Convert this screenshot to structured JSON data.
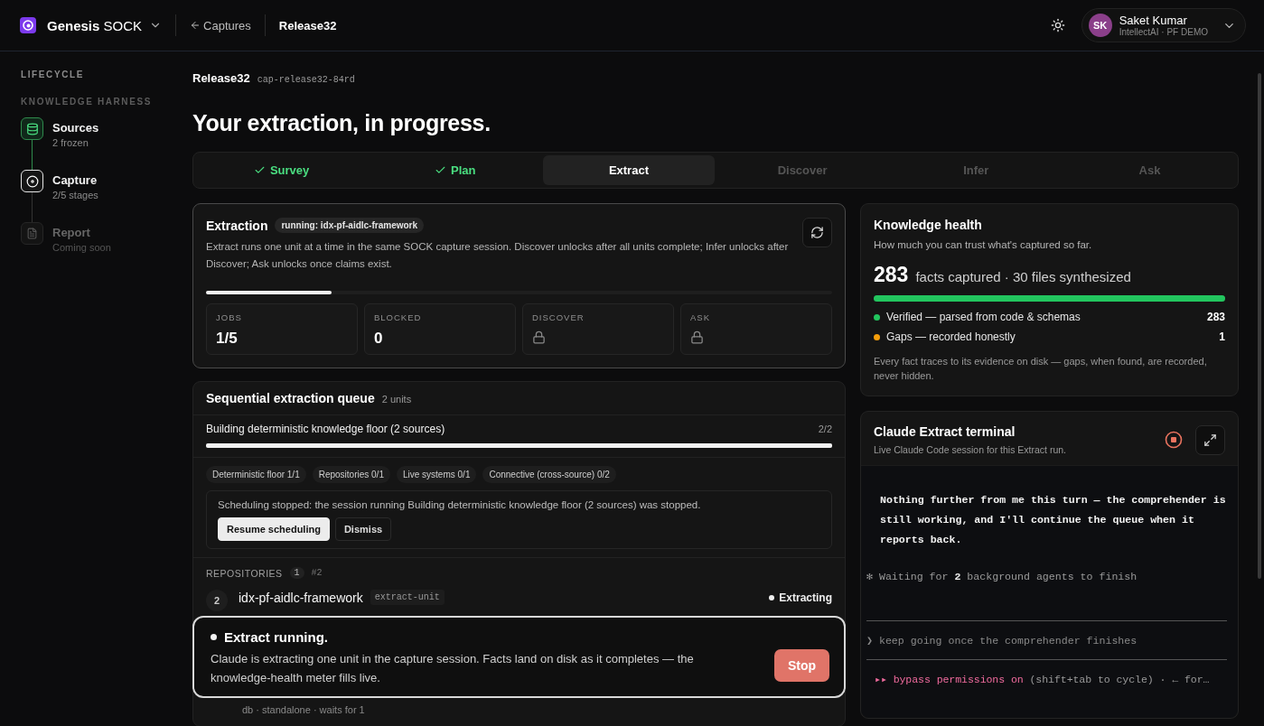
{
  "topbar": {
    "brand_bold": "Genesis",
    "brand_rest": "SOCK",
    "back": "Captures",
    "crumb": "Release32",
    "user": {
      "initials": "SK",
      "name": "Saket Kumar",
      "org": "IntellectAI · PF DEMO"
    }
  },
  "sidebar": {
    "section": "LIFECYCLE",
    "group": "KNOWLEDGE HARNESS",
    "steps": [
      {
        "label": "Sources",
        "sub": "2 frozen",
        "kind": "done"
      },
      {
        "label": "Capture",
        "sub": "2/5 stages",
        "kind": "current"
      },
      {
        "label": "Report",
        "sub": "Coming soon",
        "kind": "locked"
      }
    ]
  },
  "header": {
    "name": "Release32",
    "id": "cap-release32-84rd",
    "title": "Your extraction, in progress."
  },
  "tabs": [
    {
      "label": "Survey",
      "done": true,
      "selected": false,
      "disabled": false
    },
    {
      "label": "Plan",
      "done": true,
      "selected": false,
      "disabled": false
    },
    {
      "label": "Extract",
      "done": false,
      "selected": true,
      "disabled": false
    },
    {
      "label": "Discover",
      "done": false,
      "selected": false,
      "disabled": true
    },
    {
      "label": "Infer",
      "done": false,
      "selected": false,
      "disabled": true
    },
    {
      "label": "Ask",
      "done": false,
      "selected": false,
      "disabled": true
    }
  ],
  "extraction": {
    "title": "Extraction",
    "badge": "running: idx-pf-aidlc-framework",
    "description": "Extract runs one unit at a time in the same SOCK capture session. Discover unlocks after all units complete; Infer unlocks after Discover; Ask unlocks once claims exist.",
    "progress": {
      "level": 0.2
    },
    "stats": [
      {
        "label": "JOBS",
        "kind": "value",
        "value": "1/5"
      },
      {
        "label": "BLOCKED",
        "kind": "value",
        "value": "0"
      },
      {
        "label": "DISCOVER",
        "kind": "locked"
      },
      {
        "label": "ASK",
        "kind": "locked"
      }
    ]
  },
  "queue": {
    "title": "Sequential extraction queue",
    "count": "2 units",
    "phase": {
      "label": "Building deterministic knowledge floor (2 sources)",
      "count": "2/2",
      "level": 1
    },
    "chips": [
      "Deterministic floor 1/1",
      "Repositories 0/1",
      "Live systems 0/1",
      "Connective (cross-source) 0/2"
    ],
    "notice": {
      "text": "Scheduling stopped: the session running Building deterministic knowledge floor (2 sources) was stopped.",
      "primary": "Resume scheduling",
      "secondary": "Dismiss"
    },
    "groups": [
      {
        "label": "REPOSITORIES",
        "count": "1",
        "ref": "#2",
        "units": [
          {
            "index": "2",
            "name": "idx-pf-aidlc-framework",
            "tag": "extract-unit",
            "status": "Extracting",
            "kind": "active"
          }
        ]
      }
    ],
    "tail_meta": "db · standalone · waits for 1"
  },
  "toast": {
    "title": "Extract running.",
    "text": "Claude is extracting one unit in the capture session. Facts land on disk as it completes — the knowledge-health meter fills live.",
    "button": "Stop"
  },
  "health": {
    "title": "Knowledge health",
    "subtitle": "How much you can trust what's captured so far.",
    "big": "283",
    "summary": "facts captured · 30 files synthesized",
    "level": 1,
    "legend": [
      {
        "label": "Verified — parsed from code & schemas",
        "value": "283",
        "color": "#22c55e"
      },
      {
        "label": "Gaps — recorded honestly",
        "value": "1",
        "color": "#f59e0b"
      }
    ],
    "note": "Every fact traces to its evidence on disk — gaps, when found, are recorded, never hidden."
  },
  "terminal": {
    "title": "Claude Extract terminal",
    "subtitle": "Live Claude Code session for this Extract run.",
    "lines": [
      {
        "kind": "assistant",
        "text": "Nothing further from me this turn — the comprehender is still working, and I'll continue the queue when it reports back."
      },
      {
        "kind": "status",
        "prefix": "✻",
        "text": "Waiting for **2** background agents to finish"
      },
      {
        "kind": "prompt",
        "prefix": "❯",
        "text": "keep going once the comprehender finishes"
      },
      {
        "kind": "mode",
        "prefix": "▸▸",
        "highlight": "bypass permissions on",
        "text": "(shift+tab to cycle) · ← for…"
      }
    ]
  }
}
